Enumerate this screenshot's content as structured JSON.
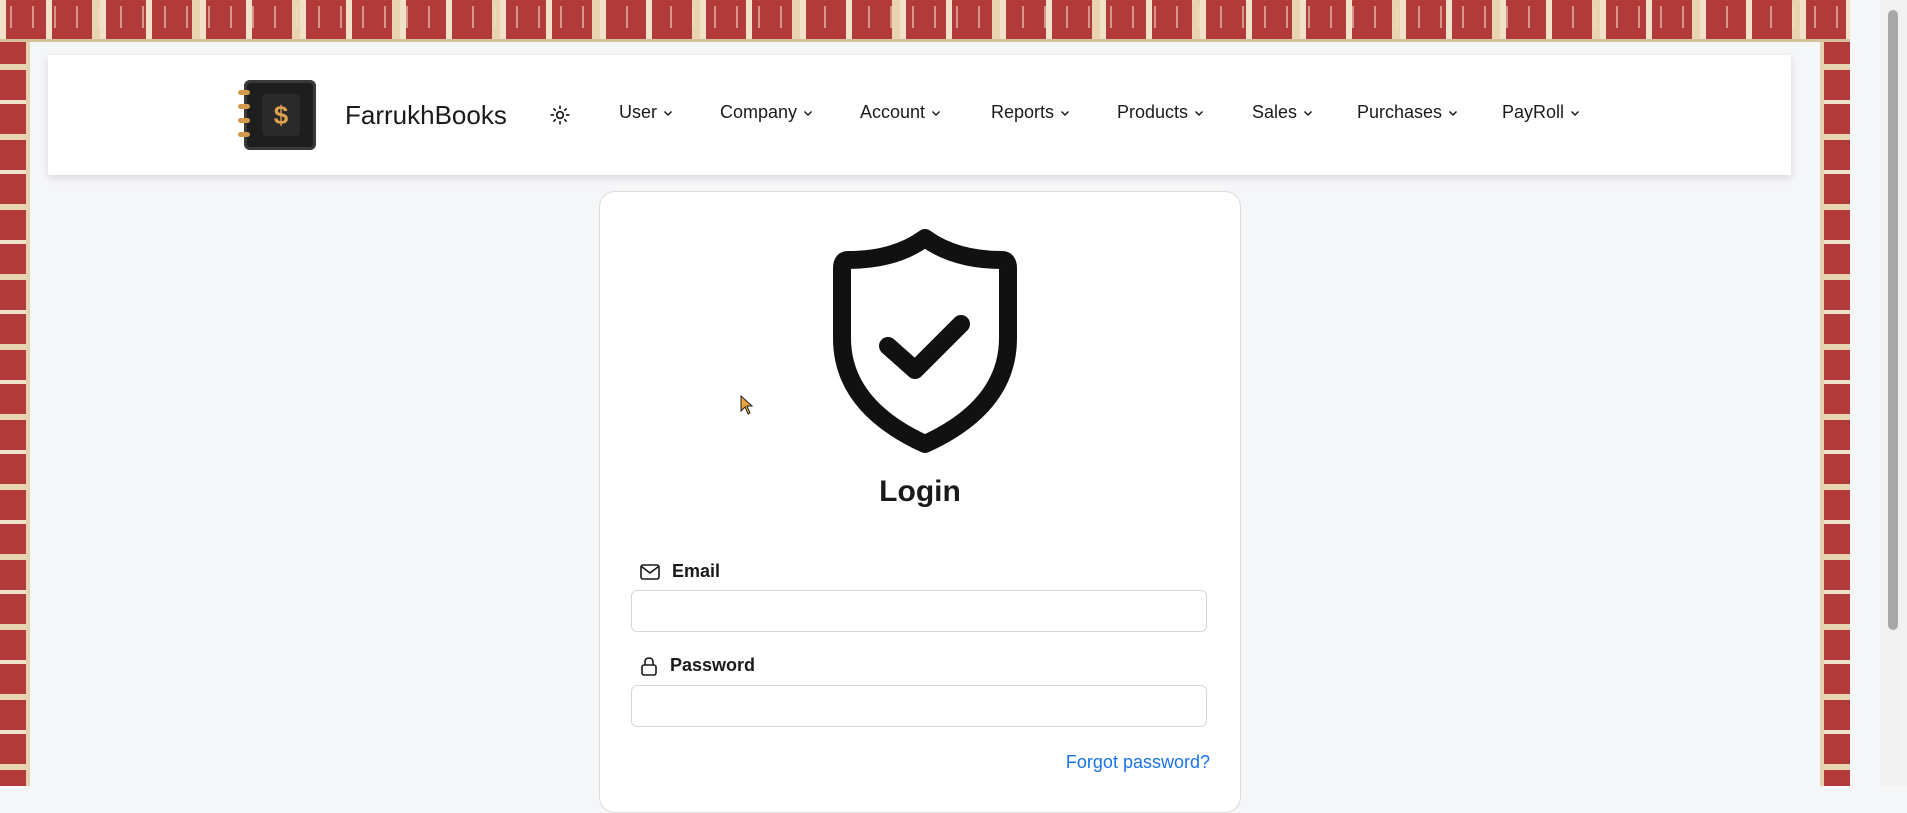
{
  "brand": {
    "name": "FarrukhBooks",
    "logo_icon": "ledger-dollar-icon",
    "logo_symbol": "$"
  },
  "nav": {
    "theme_icon": "sun-icon",
    "items": [
      {
        "label": "User"
      },
      {
        "label": "Company"
      },
      {
        "label": "Account"
      },
      {
        "label": "Reports"
      },
      {
        "label": "Products"
      },
      {
        "label": "Sales"
      },
      {
        "label": "Purchases"
      },
      {
        "label": "PayRoll"
      }
    ]
  },
  "login": {
    "title": "Login",
    "icon": "shield-check-icon",
    "email": {
      "label": "Email",
      "icon": "mail-icon",
      "value": "",
      "placeholder": ""
    },
    "password": {
      "label": "Password",
      "icon": "lock-icon",
      "value": "",
      "placeholder": ""
    },
    "forgot_link": "Forgot password?"
  },
  "colors": {
    "link": "#1a73e8",
    "frame_red": "#b23a3a",
    "frame_cream": "#f0e2c8"
  }
}
